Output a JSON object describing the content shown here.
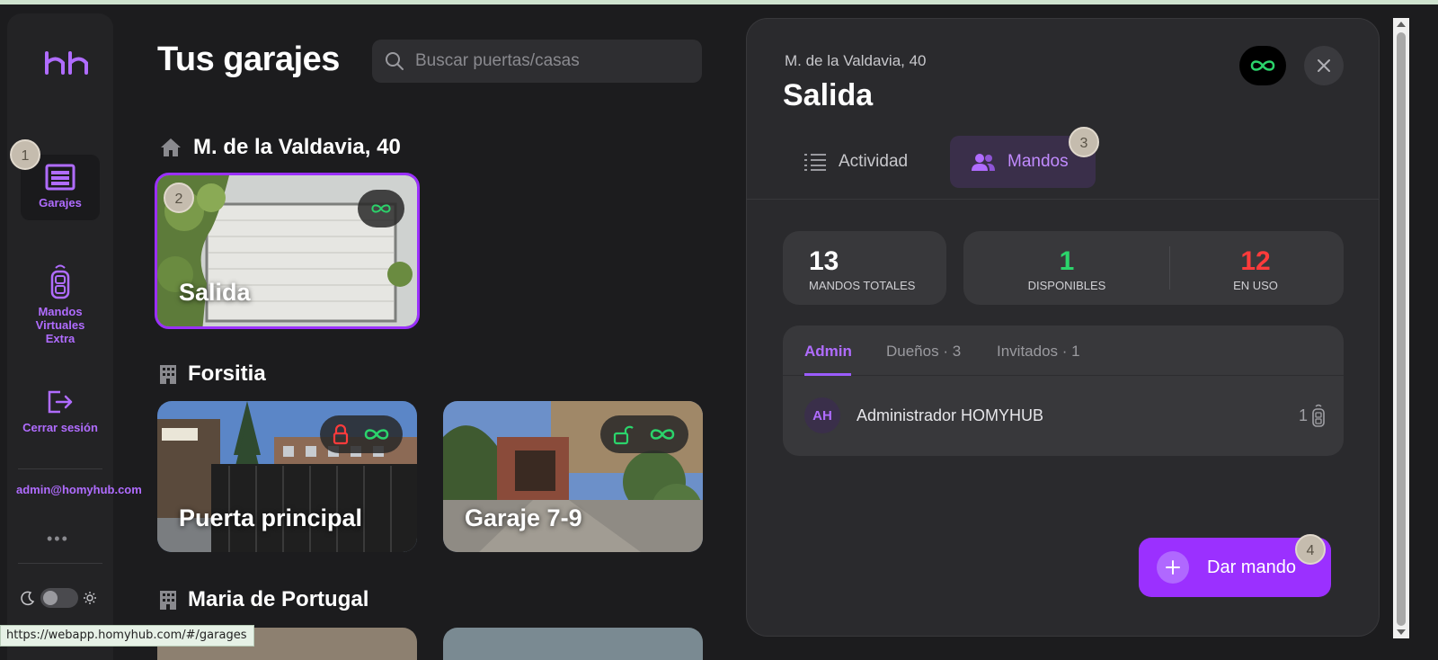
{
  "sidebar": {
    "nav": [
      {
        "label": "Garajes",
        "icon": "garage-icon"
      },
      {
        "label": "Mandos Virtuales Extra",
        "icon": "remote-icon"
      },
      {
        "label": "Cerrar sesión",
        "icon": "logout-icon"
      }
    ],
    "email": "admin@homyhub.com",
    "more": "•••"
  },
  "badges": [
    "1",
    "2",
    "3",
    "4"
  ],
  "main": {
    "title": "Tus garajes",
    "search_placeholder": "Buscar puertas/casas",
    "groups": [
      {
        "name": "M. de la Valdavia, 40",
        "icon": "house-icon",
        "cards": [
          {
            "name": "Salida",
            "selected": true,
            "icons": [
              "infinity-icon"
            ]
          }
        ]
      },
      {
        "name": "Forsitia",
        "icon": "building-icon",
        "cards": [
          {
            "name": "Puerta principal",
            "icons": [
              "lock-closed-icon",
              "infinity-icon"
            ]
          },
          {
            "name": "Garaje 7-9",
            "icons": [
              "lock-open-icon",
              "infinity-icon"
            ]
          }
        ]
      },
      {
        "name": "Maria de Portugal",
        "icon": "building-icon",
        "cards": []
      }
    ]
  },
  "status_url": "https://webapp.homyhub.com/#/garages",
  "panel": {
    "subtitle": "M. de la Valdavia, 40",
    "title": "Salida",
    "tabs": [
      "Actividad",
      "Mandos"
    ],
    "active_tab": "Mandos",
    "stats": {
      "total": {
        "value": "13",
        "label": "MANDOS TOTALES"
      },
      "available": {
        "value": "1",
        "label": "DISPONIBLES"
      },
      "in_use": {
        "value": "12",
        "label": "EN USO"
      }
    },
    "member_tabs": [
      "Admin",
      "Dueños · 3",
      "Invitados · 1"
    ],
    "members": [
      {
        "initials": "AH",
        "name": "Administrador HOMYHUB",
        "count": "1"
      }
    ],
    "add_button": "Dar mando"
  },
  "colors": {
    "accent": "#9b30ff",
    "green": "#2bd46b",
    "red": "#ff3b3b",
    "bg": "#1c1c1e"
  }
}
